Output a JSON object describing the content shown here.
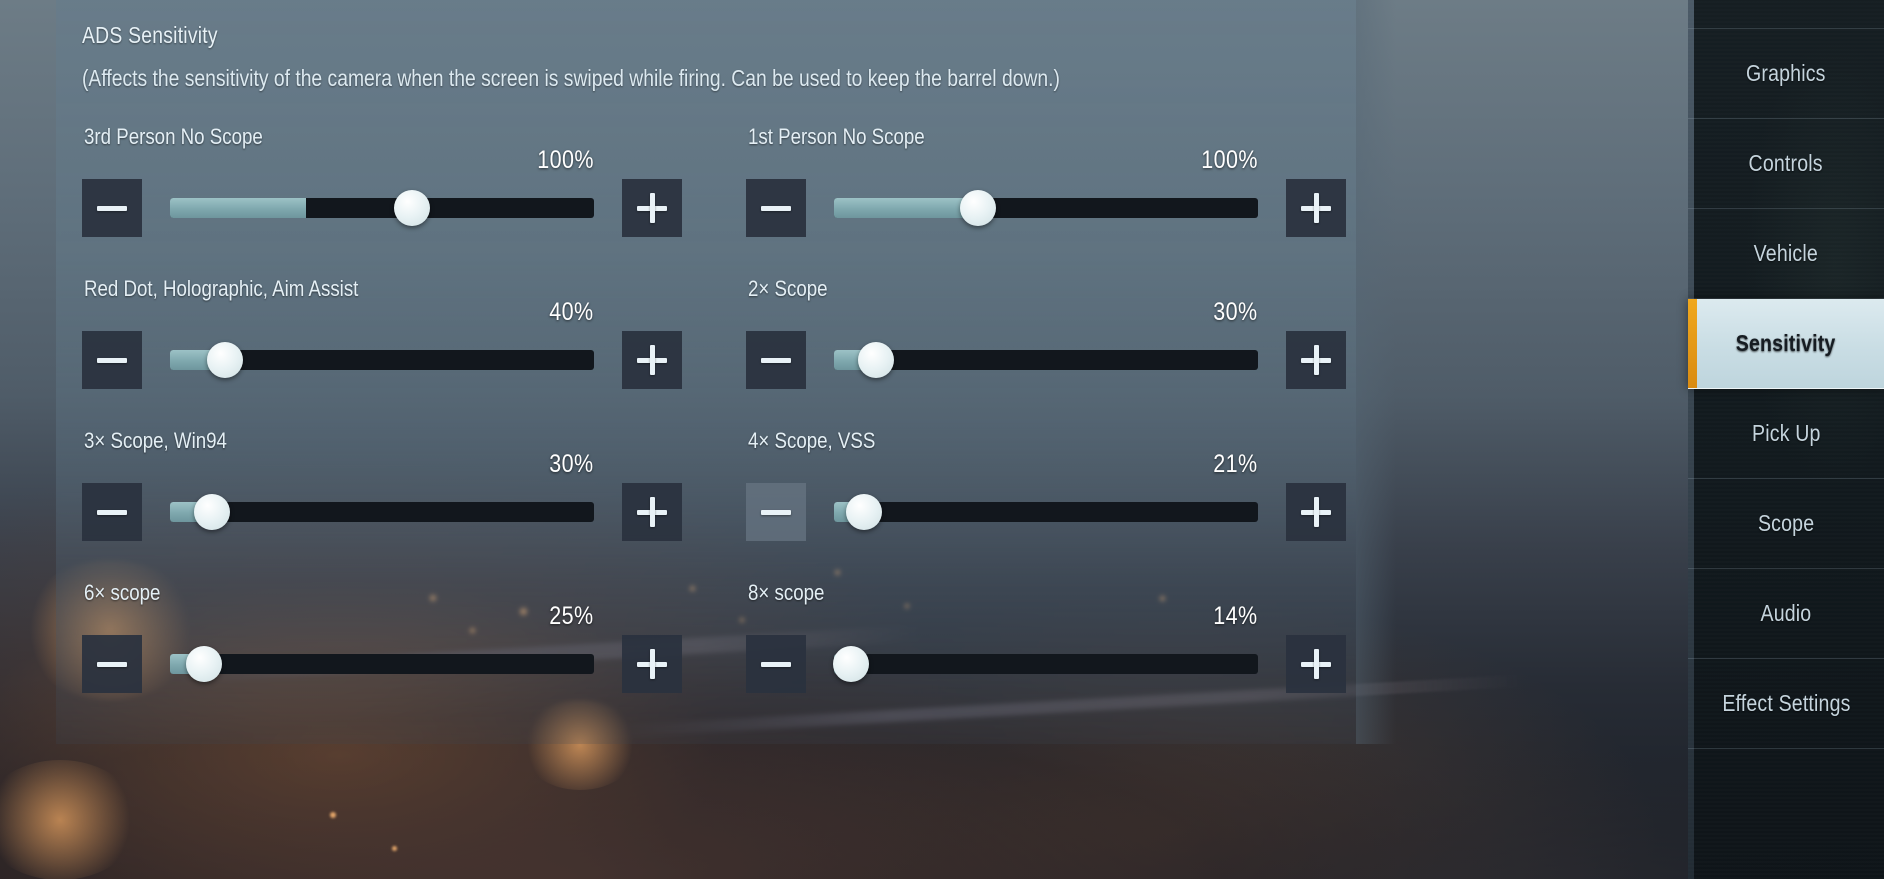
{
  "section": {
    "title": "ADS Sensitivity",
    "description": "(Affects the sensitivity of the camera when the screen is swiped while firing. Can be used to keep the barrel down.)"
  },
  "controls": {
    "decrease_glyph": "minus-icon",
    "increase_glyph": "plus-icon"
  },
  "sliders": [
    {
      "label": "3rd Person No Scope",
      "value": "100%",
      "percent": 57,
      "fill": 32,
      "pressed": false
    },
    {
      "label": "1st Person No Scope",
      "value": "100%",
      "percent": 34,
      "fill": 34,
      "pressed": false
    },
    {
      "label": "Red Dot, Holographic, Aim Assist",
      "value": "40%",
      "percent": 13,
      "fill": 12,
      "pressed": false
    },
    {
      "label": "2× Scope",
      "value": "30%",
      "percent": 10,
      "fill": 9,
      "pressed": false
    },
    {
      "label": "3× Scope, Win94",
      "value": "30%",
      "percent": 10,
      "fill": 9,
      "pressed": false
    },
    {
      "label": "4× Scope, VSS",
      "value": "21%",
      "percent": 7,
      "fill": 6,
      "pressed": true
    },
    {
      "label": "6× scope",
      "value": "25%",
      "percent": 8,
      "fill": 7,
      "pressed": false
    },
    {
      "label": "8× scope",
      "value": "14%",
      "percent": 4,
      "fill": 3,
      "pressed": false
    }
  ],
  "sidebar": {
    "items": [
      {
        "label": "Graphics",
        "active": false
      },
      {
        "label": "Controls",
        "active": false
      },
      {
        "label": "Vehicle",
        "active": false
      },
      {
        "label": "Sensitivity",
        "active": true
      },
      {
        "label": "Pick Up",
        "active": false
      },
      {
        "label": "Scope",
        "active": false
      },
      {
        "label": "Audio",
        "active": false
      },
      {
        "label": "Effect Settings",
        "active": false
      }
    ],
    "active_accent": "#f0a81e"
  },
  "theme": {
    "panel_bg": "#607482",
    "track_empty": "#12171d",
    "track_fill": "#7fa8ae",
    "thumb": "#e8f2f4",
    "button_bg": "#2a323e",
    "text_primary": "#e4eff5"
  }
}
